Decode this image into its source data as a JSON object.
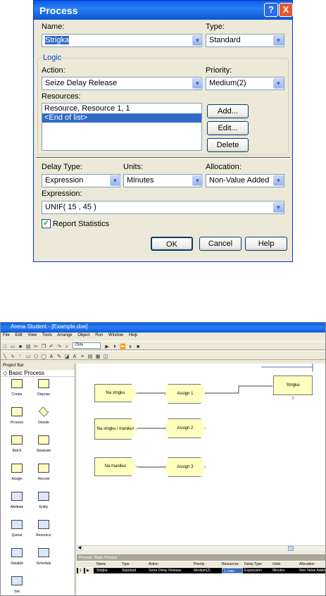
{
  "dialog": {
    "title": "Process",
    "name_label": "Name:",
    "name_value": "Strigka",
    "type_label": "Type:",
    "type_value": "Standard",
    "logic_label": "Logic",
    "action_label": "Action:",
    "action_value": "Seize Delay Release",
    "priority_label": "Priority:",
    "priority_value": "Medium(2)",
    "resources_label": "Resources:",
    "resources_items": [
      "Resource, Resource 1, 1",
      "<End of list>"
    ],
    "add_label": "Add...",
    "edit_label": "Edit...",
    "delete_label": "Delete",
    "delay_type_label": "Delay Type:",
    "delay_type_value": "Expression",
    "units_label": "Units:",
    "units_value": "Minutes",
    "allocation_label": "Allocation:",
    "allocation_value": "Non-Value Added",
    "expression_label": "Expression:",
    "expression_value": "UNIF( 15 , 45 )",
    "report_stats_label": "Report Statistics",
    "report_stats_checked": true,
    "ok_label": "OK",
    "cancel_label": "Cancel",
    "help_label": "Help",
    "help_glyph": "?",
    "close_glyph": "X"
  },
  "arena": {
    "title": "Arena Student - [Example.doe]",
    "menu": [
      "File",
      "Edit",
      "View",
      "Tools",
      "Arrange",
      "Object",
      "Run",
      "Window",
      "Help"
    ],
    "zoom": "75%",
    "project_bar_label": "Project Bar",
    "panel_label": "Basic Process",
    "modules": [
      "Create",
      "Dispose",
      "Process",
      "Decide",
      "Batch",
      "Separate",
      "Assign",
      "Record",
      "Attribute",
      "Entity",
      "Queue",
      "Resource",
      "Variable",
      "Schedule",
      "Set"
    ],
    "nodes": {
      "create1": "Na strigku",
      "create2": "Na strigku i manikur",
      "create3": "Na manikur",
      "assign1": "Assign 1",
      "assign2": "Assign 2",
      "assign3": "Assign 3",
      "process1": "Strigka"
    },
    "grid_title": "Process - Basic Process",
    "grid_headers": [
      "Name",
      "Type",
      "Action",
      "Priority",
      "Resources",
      "Delay Type",
      "Units",
      "Allocation"
    ],
    "grid_row": [
      "Strigka",
      "Standard",
      "Seize Delay Release",
      "Medium(2)",
      "1 rows",
      "Expression",
      "Minutes",
      "Non-Value Added"
    ],
    "grid_row_number": "1"
  }
}
